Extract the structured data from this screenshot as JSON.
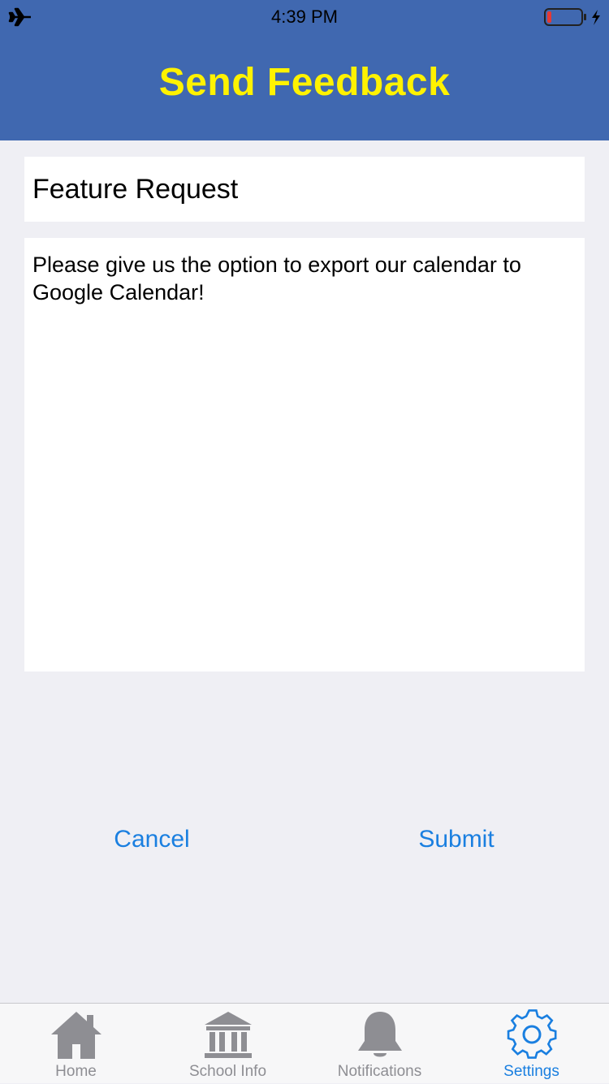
{
  "status_bar": {
    "time": "4:39 PM",
    "icons": [
      "airplane-icon",
      "battery-low-icon",
      "charging-bolt-icon"
    ],
    "battery_color": "#e53935"
  },
  "header": {
    "title": "Send Feedback",
    "background_color": "#4068b0",
    "title_color": "#fff200"
  },
  "form": {
    "subject_value": "Feature Request",
    "message_value": "Please give us the option to export our calendar to Google Calendar!"
  },
  "actions": {
    "cancel_label": "Cancel",
    "submit_label": "Submit",
    "accent_color": "#1a7fe0"
  },
  "tab_bar": {
    "items": [
      {
        "label": "Home",
        "icon": "home-icon",
        "active": false
      },
      {
        "label": "School Info",
        "icon": "school-building-icon",
        "active": false
      },
      {
        "label": "Notifications",
        "icon": "bell-icon",
        "active": false
      },
      {
        "label": "Settings",
        "icon": "gear-icon",
        "active": true
      }
    ]
  }
}
